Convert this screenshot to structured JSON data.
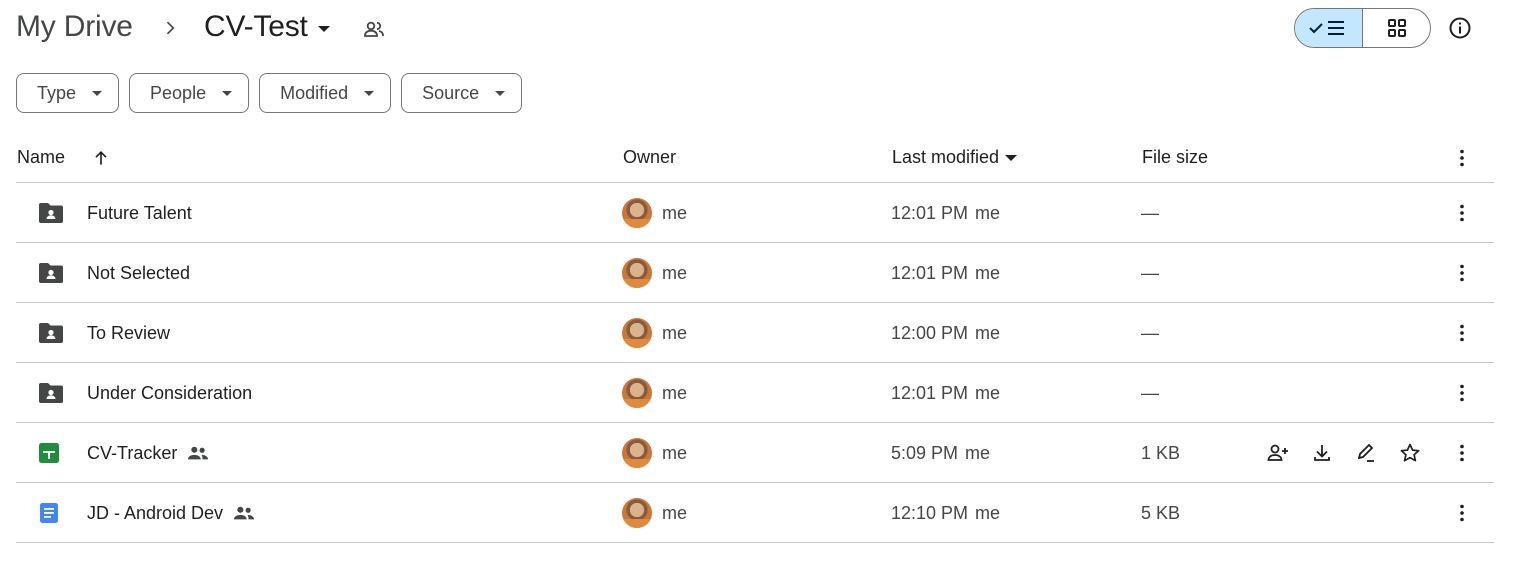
{
  "breadcrumb": {
    "root": "My Drive",
    "current": "CV-Test"
  },
  "icons": {
    "breadcrumb_separator": "chevron-right-icon",
    "shared": "people-outline-icon",
    "list_view": "check-list-icon",
    "grid_view": "grid-icon",
    "info": "info-icon",
    "sort_ascending": "arrow-up-icon",
    "more": "more-vert-icon",
    "folder": "shared-folder-icon",
    "sheets": "google-sheets-icon",
    "docs": "google-docs-icon",
    "share": "person-add-icon",
    "download": "download-icon",
    "rename": "edit-icon",
    "star": "star-icon"
  },
  "view": {
    "active": "list"
  },
  "filters": [
    {
      "label": "Type"
    },
    {
      "label": "People"
    },
    {
      "label": "Modified"
    },
    {
      "label": "Source"
    }
  ],
  "columns": {
    "name": "Name",
    "owner": "Owner",
    "last_modified": "Last modified",
    "file_size": "File size"
  },
  "rows": [
    {
      "name": "Future Talent",
      "type": "folder",
      "shared": false,
      "owner": "me",
      "modified_time": "12:01 PM",
      "modified_by": "me",
      "size": "—"
    },
    {
      "name": "Not Selected",
      "type": "folder",
      "shared": false,
      "owner": "me",
      "modified_time": "12:01 PM",
      "modified_by": "me",
      "size": "—"
    },
    {
      "name": "To Review",
      "type": "folder",
      "shared": false,
      "owner": "me",
      "modified_time": "12:00 PM",
      "modified_by": "me",
      "size": "—"
    },
    {
      "name": "Under Consideration",
      "type": "folder",
      "shared": false,
      "owner": "me",
      "modified_time": "12:01 PM",
      "modified_by": "me",
      "size": "—"
    },
    {
      "name": "CV-Tracker",
      "type": "sheets",
      "shared": true,
      "owner": "me",
      "modified_time": "5:09 PM",
      "modified_by": "me",
      "size": "1 KB",
      "hovered": true
    },
    {
      "name": "JD - Android Dev",
      "type": "docs",
      "shared": true,
      "owner": "me",
      "modified_time": "12:10 PM",
      "modified_by": "me",
      "size": "5 KB"
    }
  ],
  "colors": {
    "active_toggle": "#c2e7ff",
    "sheets_green": "#1e8e3e",
    "docs_blue": "#4285f4",
    "folder_gray": "#444746",
    "divider": "#c4c7c5"
  }
}
